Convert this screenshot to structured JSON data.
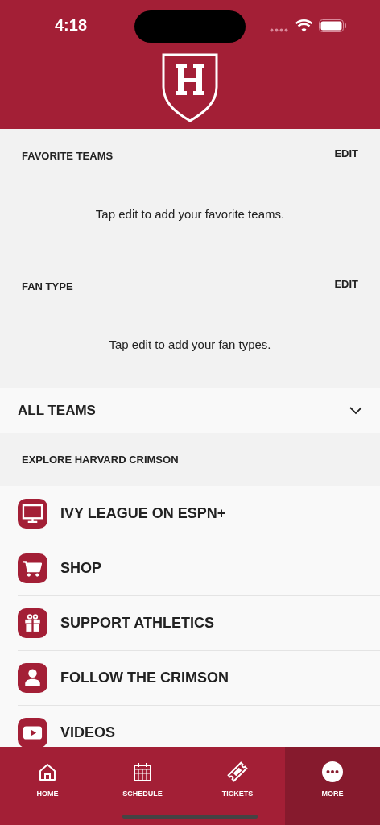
{
  "status_bar": {
    "time": "4:18"
  },
  "sections": [
    {
      "title": "FAVORITE TEAMS",
      "action": "EDIT",
      "message": "Tap edit to add your favorite teams."
    },
    {
      "title": "FAN TYPE",
      "action": "EDIT",
      "message": "Tap edit to add your fan types."
    }
  ],
  "team_selector": {
    "label": "ALL TEAMS",
    "expanded": false
  },
  "explore": {
    "title": "EXPLORE HARVARD CRIMSON",
    "items": [
      {
        "kind": "tv",
        "label": "IVY LEAGUE ON ESPN+"
      },
      {
        "kind": "cart",
        "label": "SHOP"
      },
      {
        "kind": "gift",
        "label": "SUPPORT ATHLETICS"
      },
      {
        "kind": "person",
        "label": "FOLLOW THE CRIMSON"
      },
      {
        "kind": "video",
        "label": "VIDEOS"
      }
    ]
  },
  "tab_bar": [
    {
      "kind": "home",
      "label": "HOME",
      "selected": false
    },
    {
      "kind": "schedule",
      "label": "SCHEDULE",
      "selected": false
    },
    {
      "kind": "tickets",
      "label": "TICKETS",
      "selected": false
    },
    {
      "kind": "more",
      "label": "MORE",
      "selected": true
    }
  ]
}
